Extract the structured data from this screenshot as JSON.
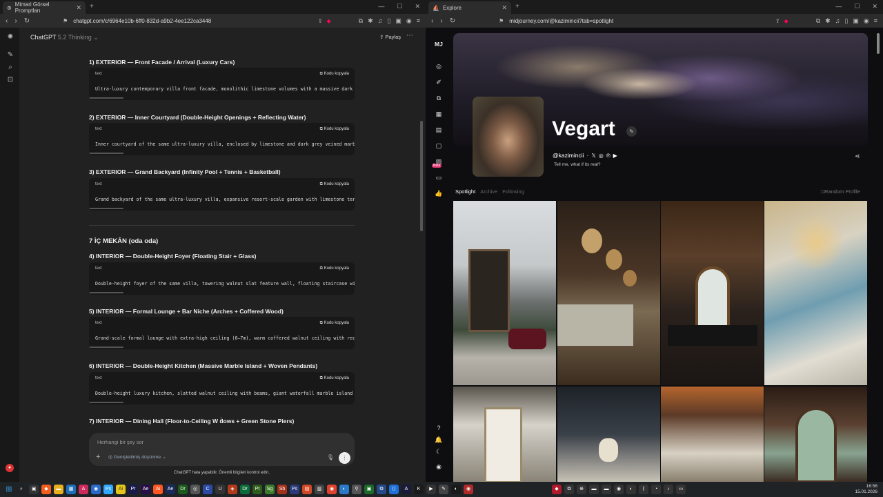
{
  "left_window": {
    "tab_title": "Mimari Görsel Promptları",
    "url": "chatgpt.com/c/6964e10b-6ff0-832d-a9b2-4ee122ca3448",
    "model_name": "ChatGPT",
    "model_version": "5.2 Thinking ⌄",
    "share_label": "Paylaş",
    "section_heading": "7 İÇ MEKÂN (oda oda)",
    "items": [
      {
        "heading": "1) EXTERIOR — Front Facade / Arrival (Luxury Cars)",
        "lang": "text",
        "copy": "Kodu kopyala",
        "code": "Ultra-luxury contemporary villa front facade, monolithic limestone volumes with a massive dark gre"
      },
      {
        "heading": "2) EXTERIOR — Inner Courtyard (Double-Height Openings + Reflecting Water)",
        "lang": "text",
        "copy": "Kodu kopyala",
        "code": "Inner courtyard of the same ultra-luxury villa, enclosed by limestone and dark grey veined marble"
      },
      {
        "heading": "3) EXTERIOR — Grand Backyard (Infinity Pool + Tennis + Basketball)",
        "lang": "text",
        "copy": "Kodu kopyala",
        "code": "Grand backyard of the same ultra-luxury villa, expansive resort-scale garden with limestone terrac"
      },
      {
        "heading": "4) INTERIOR — Double-Height Foyer (Floating Stair + Glass)",
        "lang": "text",
        "copy": "Kodu kopyala",
        "code": "Double-height foyer of the same villa, towering walnut slat feature wall, floating staircase with"
      },
      {
        "heading": "5) INTERIOR — Formal Lounge + Bar Niche (Arches + Coffered Wood)",
        "lang": "text",
        "copy": "Kodu kopyala",
        "code": "Grand-scale formal lounge with extra-high ceiling (6–7m), warm coffered walnut ceiling with reces"
      },
      {
        "heading": "6) INTERIOR — Double-Height Kitchen (Massive Marble Island + Woven Pendants)",
        "lang": "text",
        "copy": "Kodu kopyala",
        "code": "Double-height luxury kitchen, slatted walnut ceiling with beams, giant waterfall marble island (wa"
      }
    ],
    "last_heading": "7) INTERIOR — Dining Hall (Floor-to-Ceiling W  dows + Green Stone Piers)",
    "input_placeholder": "Herhangi bir şey sor",
    "input_mode": "Genişletilmiş düşünme ⌄",
    "disclaimer": "ChatGPT hata yapabilir. Önemli bilgileri kontrol edin."
  },
  "right_window": {
    "tab_title": "Explore",
    "url": "midjourney.com/@kazimincii?tab=spotlight",
    "logo": "MJ",
    "beta": "Beta",
    "profile_name": "Vegart",
    "handle": "@kazimincii",
    "bio": "Tell me, what if its real?",
    "tabs": [
      "Spotlight",
      "Archive",
      "Following"
    ],
    "random_profile": "Random Profile"
  },
  "taskbar": {
    "time": "16:56",
    "date": "15.01.2026"
  }
}
